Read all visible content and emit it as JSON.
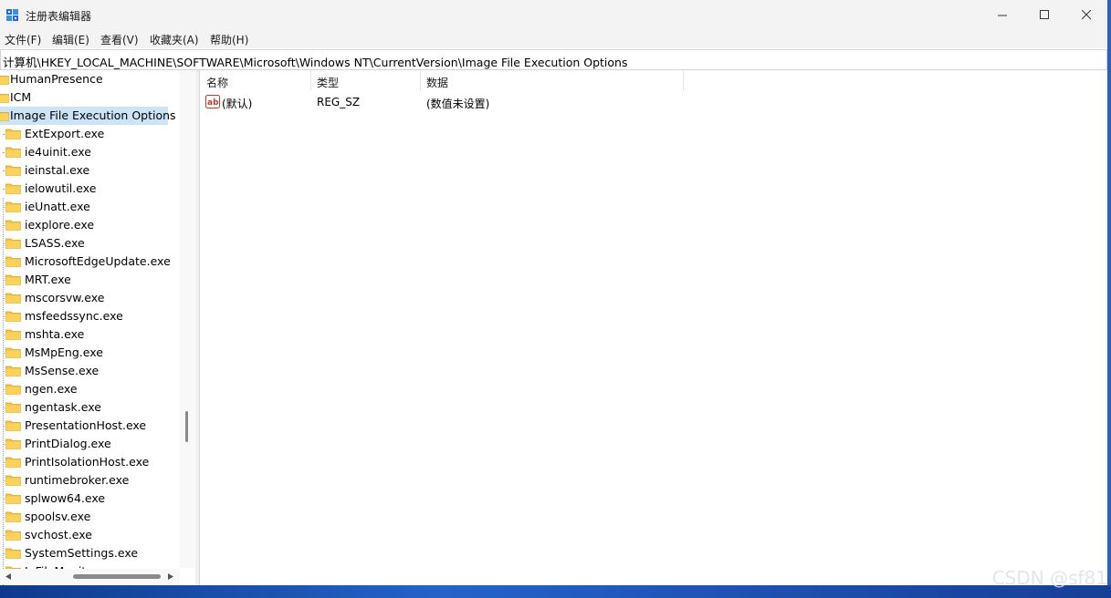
{
  "window": {
    "title": "注册表编辑器",
    "controls": {
      "minimize": "minimize-icon",
      "maximize": "maximize-icon",
      "close": "close-icon"
    }
  },
  "menu": [
    "文件(F)",
    "编辑(E)",
    "查看(V)",
    "收藏夹(A)",
    "帮助(H)"
  ],
  "address": {
    "path": "计算机\\HKEY_LOCAL_MACHINE\\SOFTWARE\\Microsoft\\Windows NT\\CurrentVersion\\Image File Execution Options"
  },
  "tree": {
    "parents": [
      "HumanPresence",
      "ICM",
      "Image File Execution Options"
    ],
    "selected": "Image File Execution Options",
    "children": [
      "ExtExport.exe",
      "ie4uinit.exe",
      "ieinstal.exe",
      "ielowutil.exe",
      "ieUnatt.exe",
      "iexplore.exe",
      "LSASS.exe",
      "MicrosoftEdgeUpdate.exe",
      "MRT.exe",
      "mscorsvw.exe",
      "msfeedssync.exe",
      "mshta.exe",
      "MsMpEng.exe",
      "MsSense.exe",
      "ngen.exe",
      "ngentask.exe",
      "PresentationHost.exe",
      "PrintDialog.exe",
      "PrintIsolationHost.exe",
      "runtimebroker.exe",
      "splwow64.exe",
      "spoolsv.exe",
      "svchost.exe",
      "SystemSettings.exe"
    ],
    "partially_hidden": "InFileMonitor"
  },
  "list": {
    "columns": [
      "名称",
      "类型",
      "数据"
    ],
    "rows": [
      {
        "name": "(默认)",
        "type": "REG_SZ",
        "data": "(数值未设置)"
      }
    ]
  },
  "watermark": "CSDN @sf81",
  "colors": {
    "selection": "#cce4f7",
    "folder": "#f5c341",
    "titlebar": "#f3f3f3"
  }
}
